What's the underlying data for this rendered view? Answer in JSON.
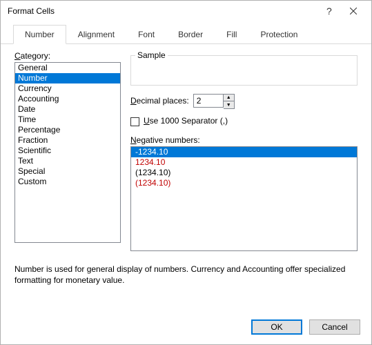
{
  "dialog": {
    "title": "Format Cells"
  },
  "tabs": {
    "items": [
      "Number",
      "Alignment",
      "Font",
      "Border",
      "Fill",
      "Protection"
    ],
    "active_index": 0
  },
  "category": {
    "label_pre": "C",
    "label_rest": "ategory:",
    "items": [
      "General",
      "Number",
      "Currency",
      "Accounting",
      "Date",
      "Time",
      "Percentage",
      "Fraction",
      "Scientific",
      "Text",
      "Special",
      "Custom"
    ],
    "selected_index": 1
  },
  "sample": {
    "label": "Sample",
    "value": ""
  },
  "decimal": {
    "label_pre": "D",
    "label_rest": "ecimal places:",
    "value": "2"
  },
  "separator": {
    "label_pre": "U",
    "label_rest": "se 1000 Separator (,)",
    "checked": false
  },
  "negative": {
    "label_pre": "N",
    "label_rest": "egative numbers:",
    "items": [
      {
        "text": "-1234.10",
        "color": "black"
      },
      {
        "text": "1234.10",
        "color": "red"
      },
      {
        "text": "(1234.10)",
        "color": "black"
      },
      {
        "text": "(1234.10)",
        "color": "red"
      }
    ],
    "selected_index": 0
  },
  "description": "Number is used for general display of numbers.  Currency and Accounting offer specialized formatting for monetary value.",
  "buttons": {
    "ok": "OK",
    "cancel": "Cancel"
  }
}
